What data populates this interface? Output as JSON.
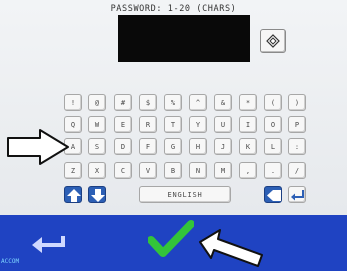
{
  "password_panel": {
    "title": "PASSWORD: 1-20 (CHARS)",
    "display_value": "",
    "reveal_icon": "eye-icon"
  },
  "keyboard": {
    "rows": [
      [
        "!",
        "@",
        "#",
        "$",
        "%",
        "^",
        "&",
        "*",
        "(",
        ")"
      ],
      [
        "Q",
        "W",
        "E",
        "R",
        "T",
        "Y",
        "U",
        "I",
        "O",
        "P"
      ],
      [
        "A",
        "S",
        "D",
        "F",
        "G",
        "H",
        "J",
        "K",
        "L",
        ":"
      ],
      [
        "Z",
        "X",
        "C",
        "V",
        "B",
        "N",
        "M",
        ",",
        ".",
        "/"
      ]
    ],
    "language_label": "ENGLISH",
    "shift_up_icon": "arrow-up-icon",
    "shift_down_icon": "arrow-down-icon",
    "backspace_icon": "backspace-icon",
    "enter_icon": "enter-icon"
  },
  "bottom_bar": {
    "back_icon": "back-arrow-icon",
    "confirm_icon": "checkmark-icon",
    "corner_text": "ACCOM"
  },
  "annotations": {
    "arrow_1": "pointer-arrow-icon",
    "arrow_2": "pointer-arrow-icon"
  },
  "colors": {
    "bottom_bar": "#1f43c2",
    "display": "#090909",
    "confirm": "#33c43a",
    "blue_key": "#2c5fb5"
  }
}
